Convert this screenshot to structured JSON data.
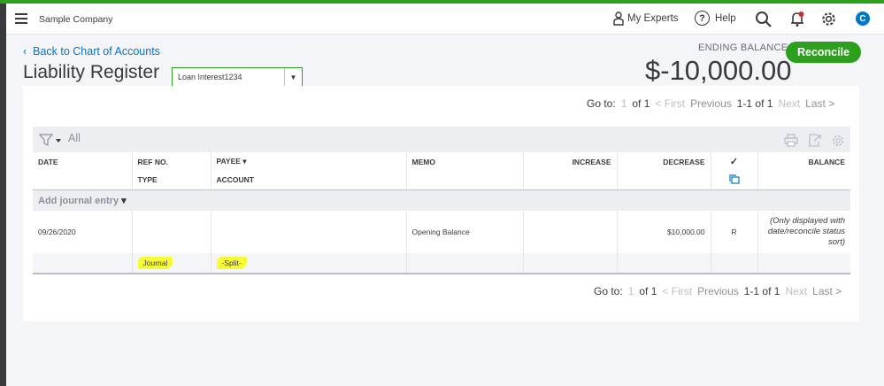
{
  "topbar": {
    "company": "Sample Company",
    "my_experts": "My Experts",
    "help": "Help",
    "help_glyph": "?",
    "avatar_initial": "C",
    "icons": [
      "menu-icon",
      "expert-icon",
      "help-icon",
      "search-icon",
      "notification-bell-icon",
      "gear-icon"
    ]
  },
  "header": {
    "back_link": "Back to Chart of Accounts",
    "title": "Liability Register",
    "account_select": "Loan Interest1234",
    "ending_balance_label": "ENDING BALANCE",
    "ending_balance": "$-10,000.00",
    "reconcile": "Reconcile"
  },
  "pager_top": {
    "goto": "Go to:",
    "page": "1",
    "of": "of 1",
    "first": "< First",
    "previous": "Previous",
    "range": "1-1 of 1",
    "next": "Next",
    "last": "Last >"
  },
  "pager_bottom": {
    "goto": "Go to:",
    "page": "1",
    "of": "of 1",
    "first": "< First",
    "previous": "Previous",
    "range": "1-1 of 1",
    "next": "Next",
    "last": "Last >"
  },
  "filter": {
    "all": "All"
  },
  "table": {
    "headers": {
      "date": "DATE",
      "ref_no": "REF NO.",
      "type": "TYPE",
      "payee": "PAYEE",
      "account": "ACCOUNT",
      "memo": "MEMO",
      "increase": "INCREASE",
      "decrease": "DECREASE",
      "check": "✓",
      "balance": "BALANCE"
    },
    "add_entry": "Add journal entry",
    "rows": [
      {
        "date": "09/26/2020",
        "ref_no": "",
        "type": "Journal",
        "payee": "",
        "account": "-Split-",
        "memo": "Opening Balance",
        "increase": "",
        "decrease": "$10,000.00",
        "reconcile_status": "R",
        "balance": "(Only displayed with date/reconcile status sort)"
      }
    ]
  },
  "colors": {
    "accent": "#2ca01c",
    "link": "#0077c5",
    "highlight": "#f6fb35"
  }
}
